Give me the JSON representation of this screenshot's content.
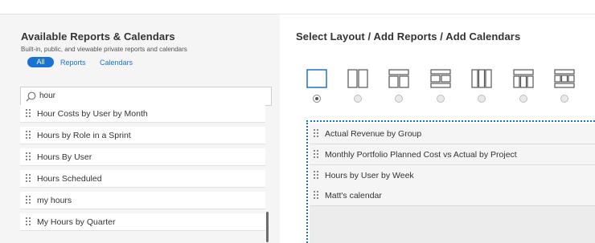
{
  "left_panel": {
    "title": "Available Reports & Calendars",
    "subtitle": "Built-in, public, and viewable private reports and calendars",
    "filters": {
      "all": "All",
      "reports": "Reports",
      "calendars": "Calendars"
    },
    "search": {
      "value": "hour",
      "icon": "search-icon"
    },
    "items": [
      {
        "label": "Hour Costs by User by Month"
      },
      {
        "label": "Hours by Role in a Sprint"
      },
      {
        "label": "Hours By User"
      },
      {
        "label": "Hours Scheduled"
      },
      {
        "label": "my hours"
      },
      {
        "label": "My Hours by Quarter"
      }
    ]
  },
  "right_panel": {
    "title": "Select Layout / Add Reports / Add Calendars",
    "layouts": [
      {
        "icon": "single-column-layout-icon",
        "selected": true
      },
      {
        "icon": "two-column-layout-icon",
        "selected": false
      },
      {
        "icon": "top-plus-two-column-layout-icon",
        "selected": false
      },
      {
        "icon": "top-two-column-bottom-layout-icon",
        "selected": false
      },
      {
        "icon": "three-column-layout-icon",
        "selected": false
      },
      {
        "icon": "top-plus-three-column-layout-icon",
        "selected": false
      },
      {
        "icon": "top-three-column-bottom-layout-icon",
        "selected": false
      }
    ],
    "selected_items": [
      {
        "label": "Actual Revenue by Group"
      },
      {
        "label": "Monthly Portfolio Planned Cost vs Actual by Project"
      },
      {
        "label": "Hours by User by Week"
      },
      {
        "label": "Matt's calendar"
      }
    ]
  },
  "colors": {
    "accent": "#1b72d6",
    "panel_bg": "#f5f5f5",
    "text": "#333333"
  }
}
